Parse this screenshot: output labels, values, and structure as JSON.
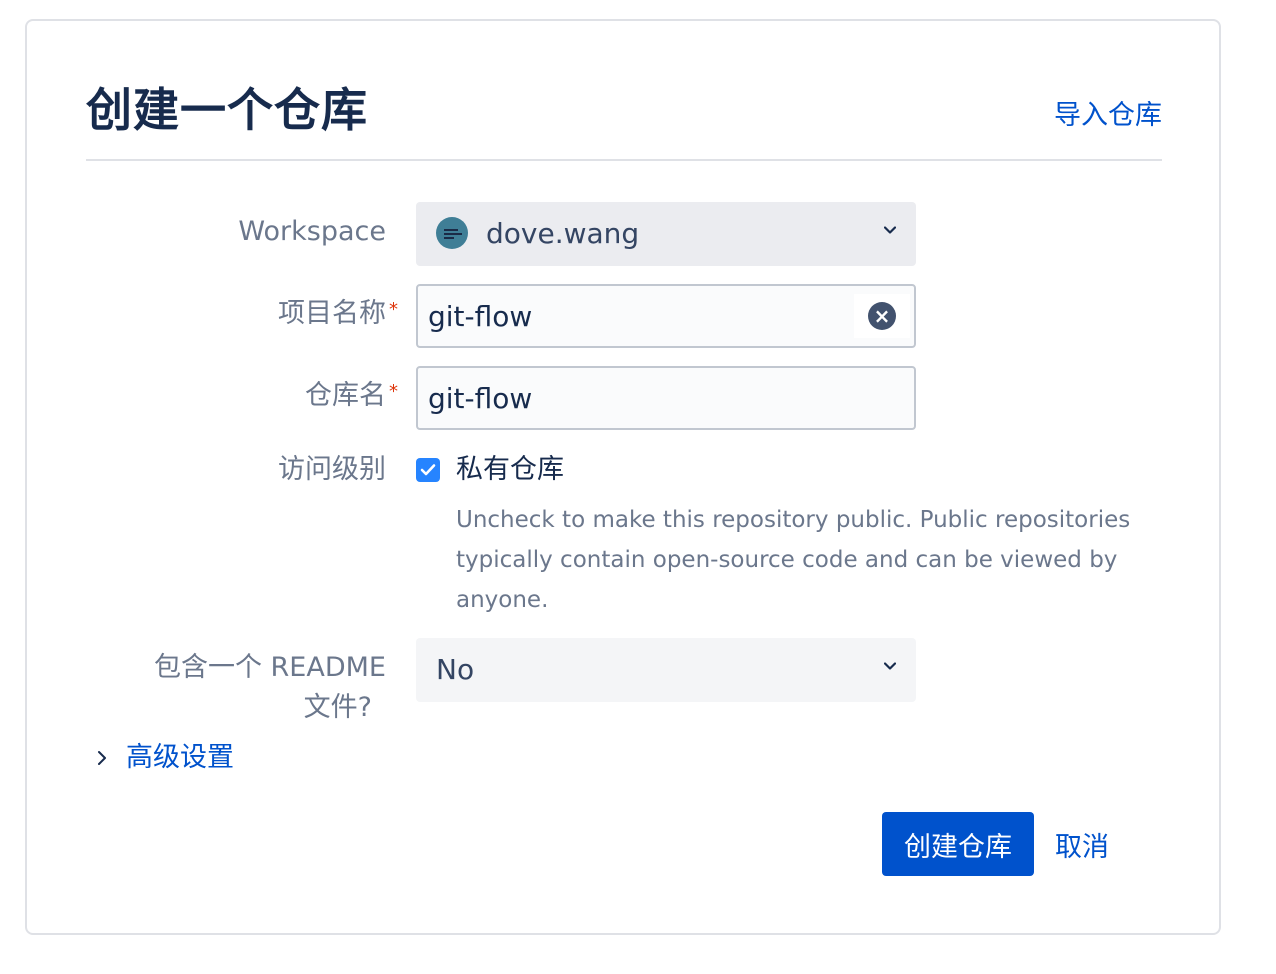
{
  "dialog": {
    "title": "创建一个仓库",
    "import_link": "导入仓库"
  },
  "form": {
    "workspace": {
      "label": "Workspace",
      "value": "dove.wang",
      "avatar_icon": "workspace-avatar-icon"
    },
    "project_name": {
      "label": "项目名称",
      "required_mark": "*",
      "value": "git-flow",
      "clear_icon": "clear-icon"
    },
    "repo_name": {
      "label": "仓库名",
      "required_mark": "*",
      "value": "git-flow"
    },
    "access": {
      "label": "访问级别",
      "checkbox_label": "私有仓库",
      "checked": true,
      "help": "Uncheck to make this repository public. Public repositories typically contain open-source code and can be viewed by anyone."
    },
    "readme": {
      "label_line1": "包含一个 README",
      "label_line2": "文件?",
      "value": "No"
    },
    "advanced": {
      "label": "高级设置"
    }
  },
  "actions": {
    "create": "创建仓库",
    "cancel": "取消"
  },
  "colors": {
    "primary": "#0052cc",
    "checkbox": "#2684ff",
    "required": "#de350b"
  }
}
